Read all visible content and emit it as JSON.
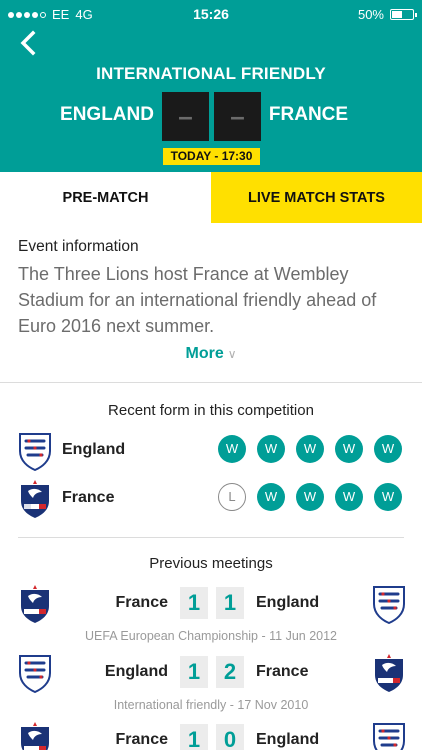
{
  "status_bar": {
    "carrier": "EE",
    "network": "4G",
    "time": "15:26",
    "battery": "50%",
    "battery_level": 0.5
  },
  "header": {
    "competition": "INTERNATIONAL FRIENDLY",
    "home_team": "ENGLAND",
    "away_team": "FRANCE",
    "home_score": "–",
    "away_score": "–",
    "kickoff": "TODAY - 17:30"
  },
  "tabs": [
    {
      "label": "PRE-MATCH"
    },
    {
      "label": "LIVE MATCH STATS"
    }
  ],
  "event": {
    "label": "Event information",
    "text": "The Three Lions host France at Wembley Stadium for an international friendly ahead of Euro 2016 next summer.",
    "more": "More"
  },
  "recent_form": {
    "title": "Recent form in this competition",
    "teams": [
      {
        "name": "England",
        "results": [
          "W",
          "W",
          "W",
          "W",
          "W"
        ]
      },
      {
        "name": "France",
        "results": [
          "L",
          "W",
          "W",
          "W",
          "W"
        ]
      }
    ]
  },
  "previous_meetings": {
    "title": "Previous meetings",
    "matches": [
      {
        "left_team": "France",
        "left_score": "1",
        "right_score": "1",
        "right_team": "England",
        "info": "UEFA European Championship - 11 Jun 2012"
      },
      {
        "left_team": "England",
        "left_score": "1",
        "right_score": "2",
        "right_team": "France",
        "info": "International friendly - 17 Nov 2010"
      },
      {
        "left_team": "France",
        "left_score": "1",
        "right_score": "0",
        "right_team": "England",
        "info": ""
      }
    ]
  },
  "colors": {
    "accent": "#009e97",
    "highlight": "#ffe000",
    "score_box": "#1a1a1a"
  }
}
